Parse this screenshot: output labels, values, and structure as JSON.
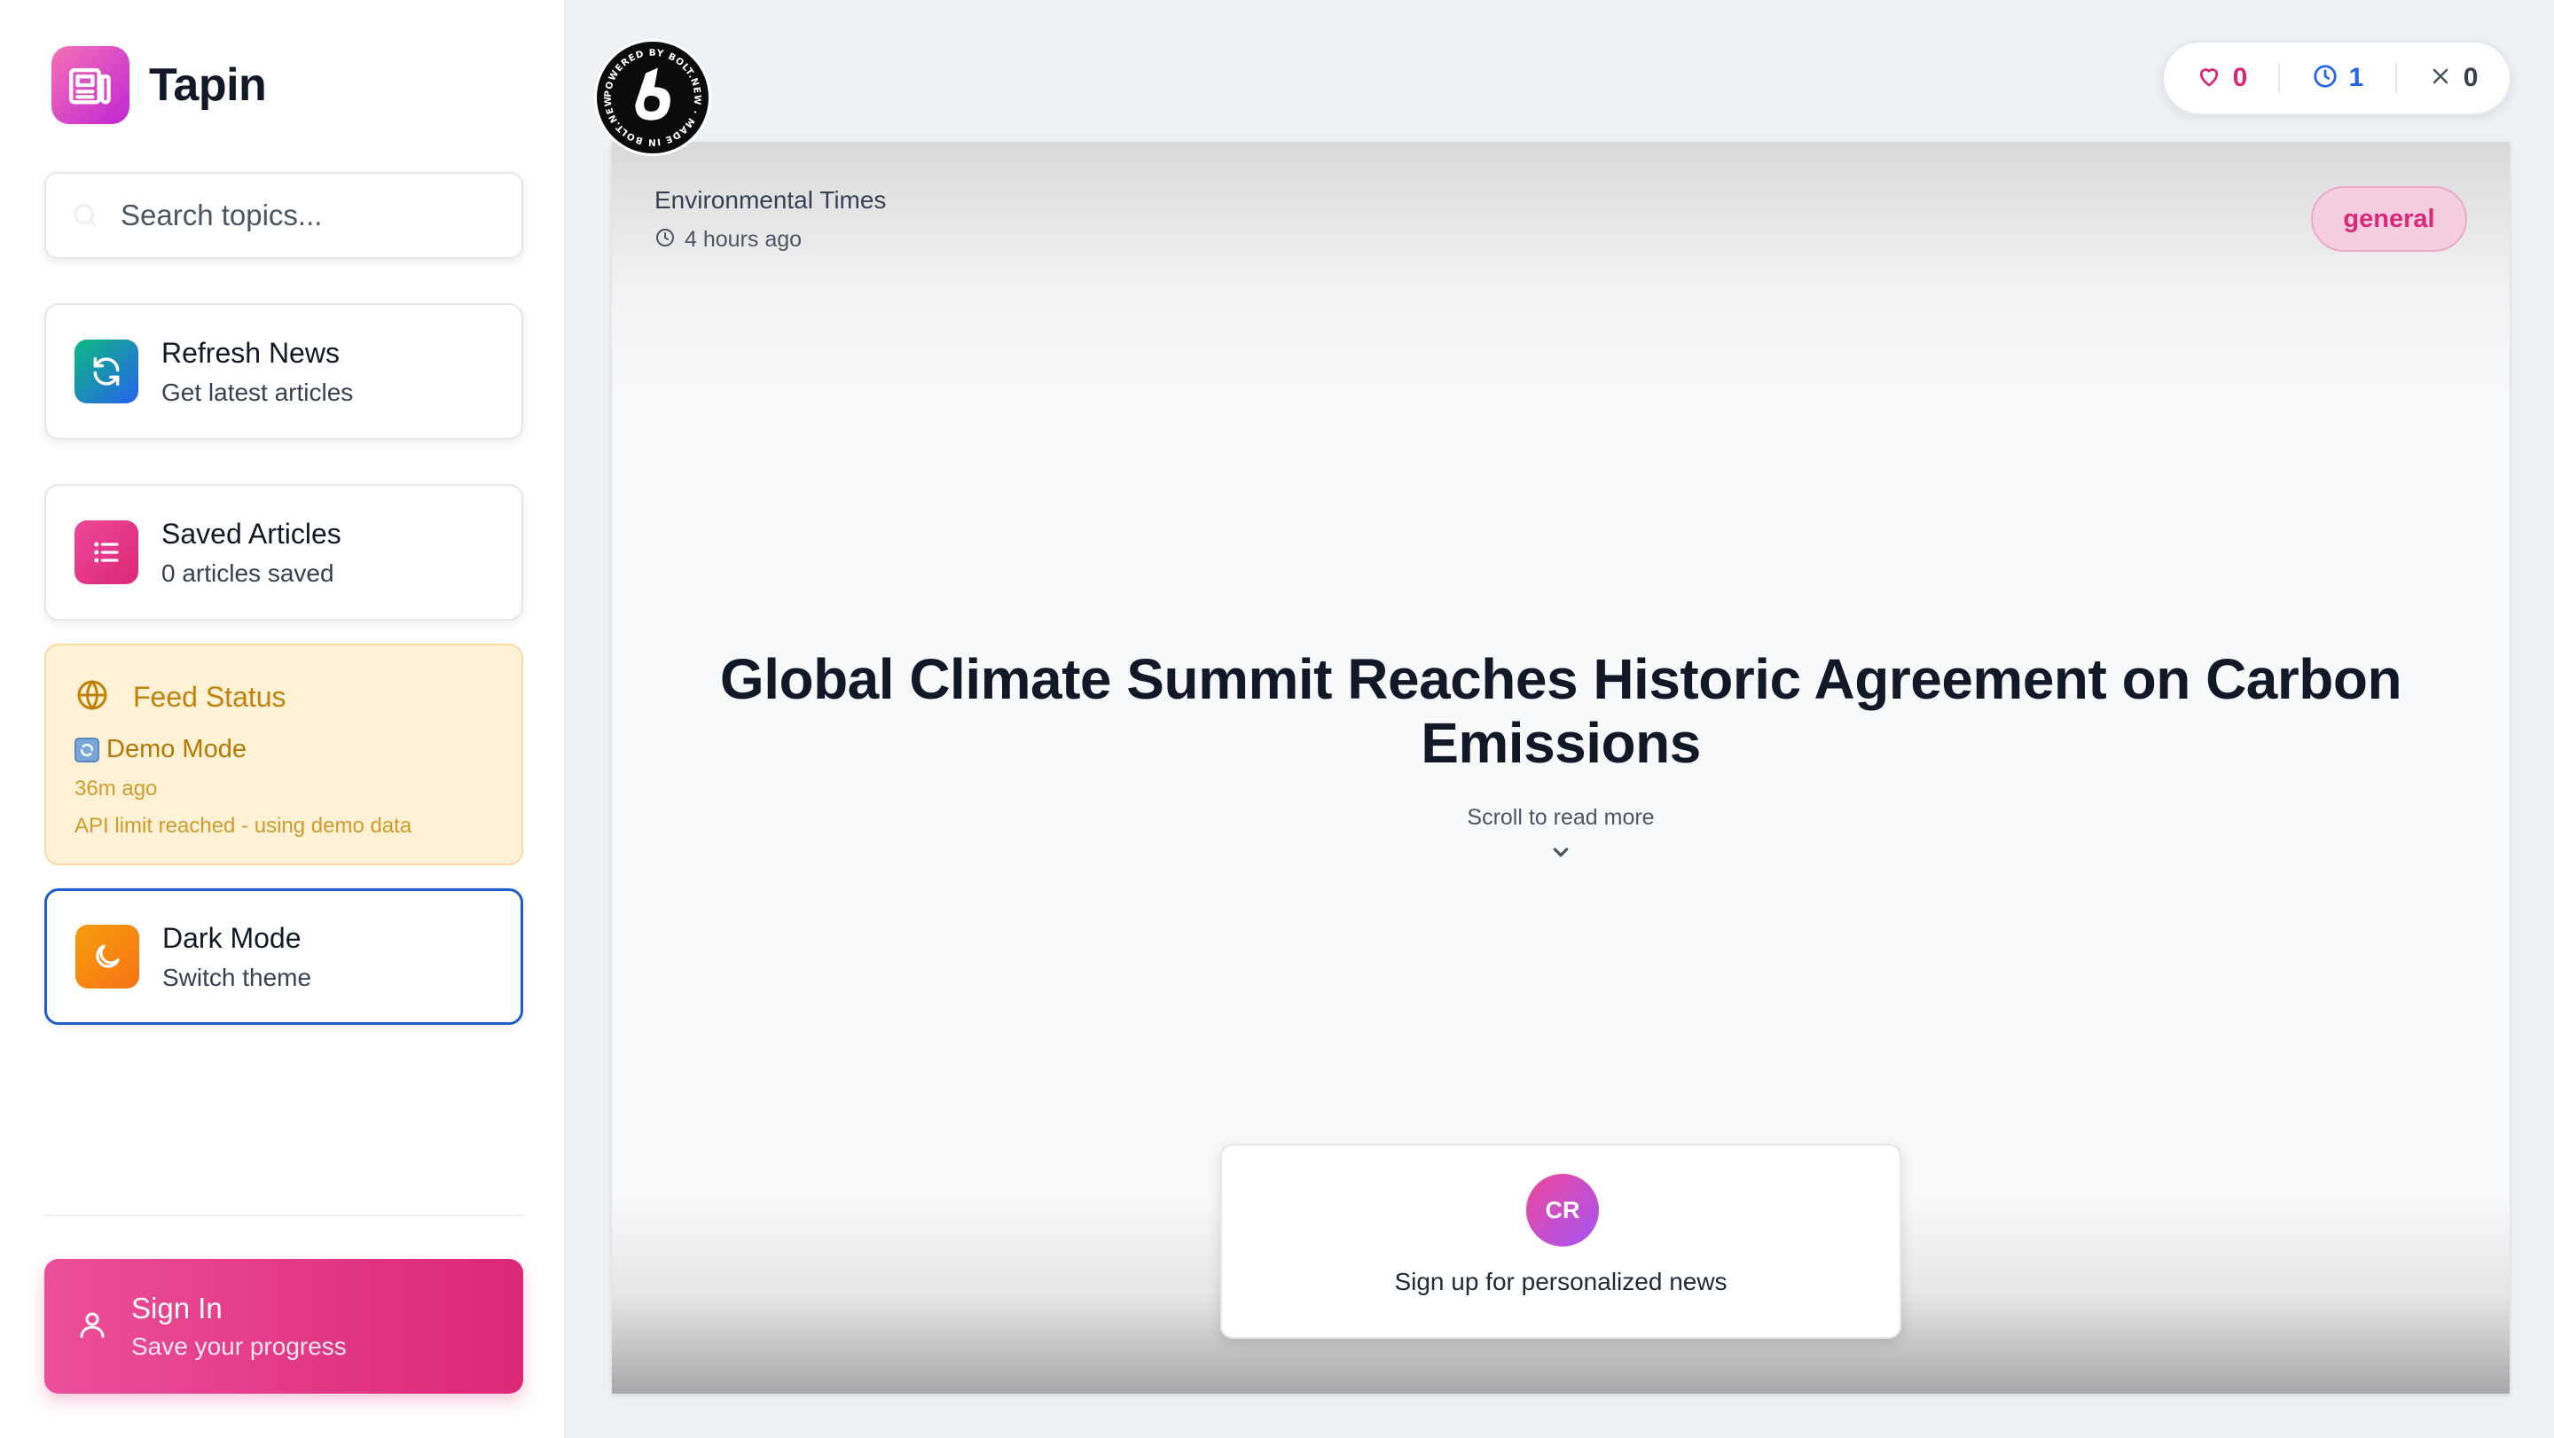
{
  "app": {
    "name": "Tapin"
  },
  "sidebar": {
    "search": {
      "placeholder": "Search topics..."
    },
    "refresh": {
      "title": "Refresh News",
      "subtitle": "Get latest articles"
    },
    "saved": {
      "title": "Saved Articles",
      "subtitle": "0 articles saved"
    },
    "feed_status": {
      "title": "Feed Status",
      "mode": "Demo Mode",
      "updated": "36m ago",
      "note": "API limit reached - using demo data"
    },
    "dark_mode": {
      "title": "Dark Mode",
      "subtitle": "Switch theme"
    },
    "sign_in": {
      "title": "Sign In",
      "subtitle": "Save your progress"
    }
  },
  "stats": {
    "liked": "0",
    "later": "1",
    "skipped": "0"
  },
  "article": {
    "source": "Environmental Times",
    "time": "4 hours ago",
    "category": "general",
    "headline": "Global Climate Summit Reaches Historic Agreement on Carbon Emissions",
    "scroll_hint": "Scroll to read more"
  },
  "signup": {
    "initials": "CR",
    "text": "Sign up for personalized news"
  },
  "badge": {
    "text": "POWERED BY BOLT.NEW · MADE IN BOLT.NEW ·"
  },
  "colors": {
    "accent_pink": "#db2777",
    "accent_blue": "#2563eb",
    "warning": "#c2820a",
    "dark_mode_border": "#1d5fc7"
  },
  "icons": {
    "logo": "newspaper-icon",
    "search": "search-icon",
    "refresh": "refresh-icon",
    "saved": "list-icon",
    "feed": "globe-icon",
    "dark": "moon-icon",
    "signin": "user-icon",
    "like": "heart-icon",
    "later": "clock-icon",
    "skip": "x-icon"
  }
}
